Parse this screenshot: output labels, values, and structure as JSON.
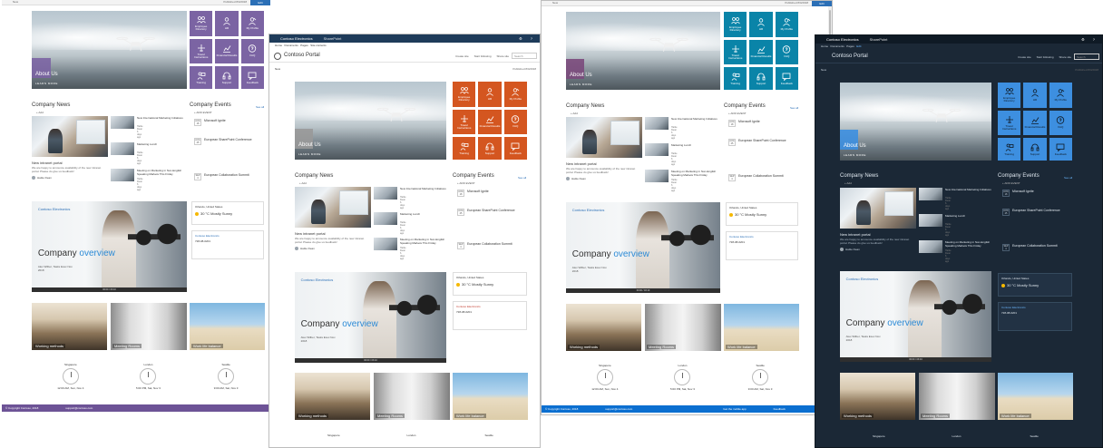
{
  "common": {
    "site_title": "Contoso Portal",
    "suite_app": "Contoso Electronics",
    "suite_module": "SharePoint",
    "nav_home": "Home",
    "nav_links": [
      "Home",
      "Documents",
      "Pages",
      "Site contents"
    ],
    "actions": [
      "Create site",
      "Start following",
      "Share site"
    ],
    "search_placeholder": "Search",
    "new_label": "New",
    "published": "Published 8/4/2018",
    "edit": "Edit",
    "about_us": "About Us",
    "learn_more": "LEARN MORE",
    "company_news": "Company News",
    "company_events": "Company Events",
    "see_all": "See all",
    "add_label": "+ Add",
    "add_event": "+ ADD EVENT",
    "main_news_title": "New intranet portal",
    "main_news_desc": "We are happy to announce availability of the new intranet portal. Please do give us feedback!",
    "main_news_author": "Hattie Dean",
    "main_news_date": "6 days ago",
    "small_news": [
      {
        "title": "New International Marketing Initiatives",
        "meta": "Hattie Dean 6 days ago"
      },
      {
        "title": "Marketing Lunch",
        "meta": "Hattie Dean 6 days ago"
      },
      {
        "title": "Meeting on Marketing in Non-English Speaking Markets This Friday",
        "meta": "Hattie Dean 6 days ago"
      }
    ],
    "events": [
      {
        "date": "AUG 18",
        "name": "Microsoft Ignite"
      },
      {
        "date": "AUG 25",
        "name": "European SharePoint Conference"
      },
      {
        "date": "SEP 4",
        "name": "European Collaboration Summit"
      }
    ],
    "video_brand": "Contoso Electronics",
    "video_title_a": "Company ",
    "video_title_b": "overview",
    "video_who": "Alex Wilber, Tasks Exec Nov 2018",
    "video_ctrl": "00:00 / 03:10",
    "weather_place": "Orlando, United States",
    "weather_temp": "30 °C  Mostly Sunny",
    "contact_heading": "Contoso Electronics",
    "contact_phone": "728-08-0201",
    "photos": [
      "Working methods",
      "Meeting Rooms",
      "Work life balance"
    ],
    "cities": [
      "Singapore",
      "London",
      "Seattle"
    ],
    "city_times": [
      "12:00 AM, Sun, Nov 4",
      "5:00 PM, Sat, Nov 3",
      "9:00 AM, Sat, Nov 3"
    ],
    "footer_copy": "© Copyright Contoso, 2018",
    "footer_mail": "support@contoso.com",
    "footer_app": "Get the mobile app",
    "footer_feedback": "Feedback"
  },
  "tiles": [
    {
      "label": "Employee Directory",
      "icon": "people-icon"
    },
    {
      "label": "HR",
      "icon": "person-icon"
    },
    {
      "label": "My Profile",
      "icon": "profile-icon"
    },
    {
      "label": "Travel Instructions",
      "icon": "plane-icon"
    },
    {
      "label": "Financial Results",
      "icon": "chart-icon"
    },
    {
      "label": "FAQ",
      "icon": "question-icon"
    },
    {
      "label": "Training",
      "icon": "training-icon"
    },
    {
      "label": "Support",
      "icon": "headset-icon"
    },
    {
      "label": "Feedback",
      "icon": "feedback-icon"
    }
  ],
  "themes": {
    "purple": "#7b64a3",
    "orange": "#d45620",
    "teal": "#0a84a8",
    "blue_light": "#3d8fe0",
    "footer_purple": "#6d5396",
    "footer_blue": "#0b6fd0"
  }
}
